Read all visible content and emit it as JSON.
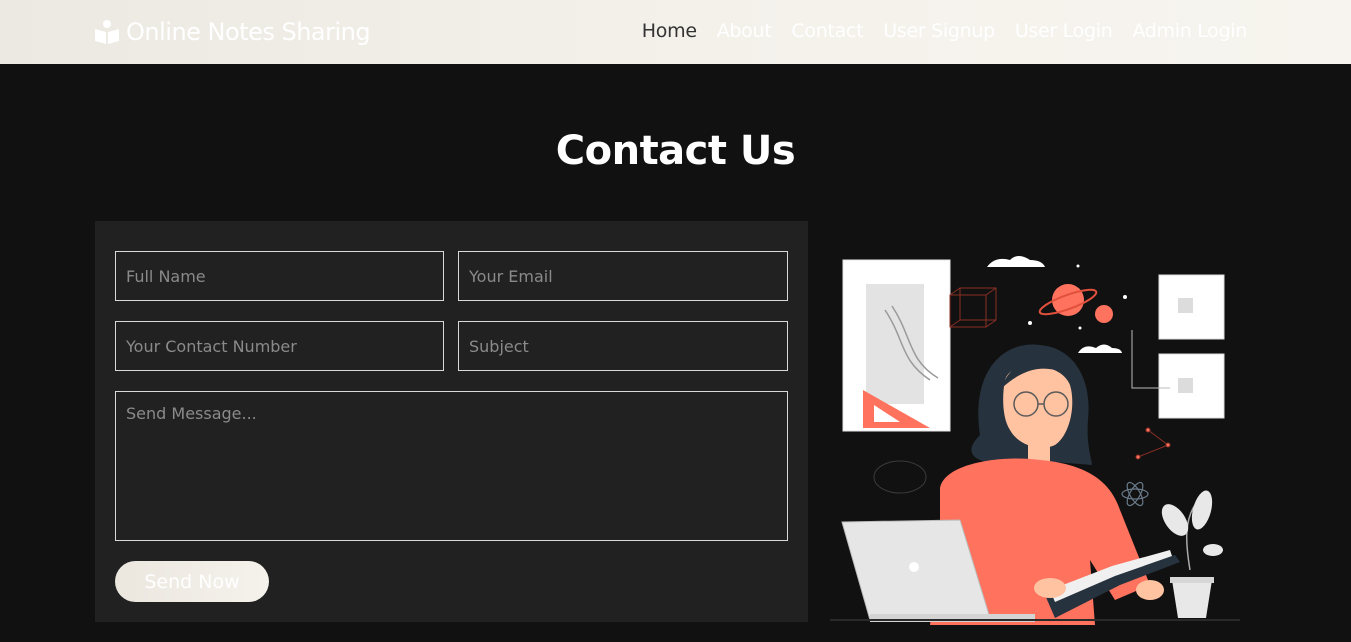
{
  "brand": {
    "name": "Online Notes Sharing",
    "icon": "reader-icon"
  },
  "nav": {
    "items": [
      {
        "label": "Home",
        "active": true
      },
      {
        "label": "About",
        "active": false
      },
      {
        "label": "Contact",
        "active": false
      },
      {
        "label": "User Signup",
        "active": false
      },
      {
        "label": "User Login",
        "active": false
      },
      {
        "label": "Admin Login",
        "active": false
      }
    ]
  },
  "contact": {
    "title": "Contact Us",
    "form": {
      "full_name_placeholder": "Full Name",
      "email_placeholder": "Your Email",
      "contact_number_placeholder": "Your Contact Number",
      "subject_placeholder": "Subject",
      "message_placeholder": "Send Message...",
      "submit_label": "Send Now"
    }
  },
  "colors": {
    "page_background": "#111111",
    "panel_background": "#212121",
    "navbar_background": "#f3f0ea",
    "accent": "#ff725e"
  }
}
